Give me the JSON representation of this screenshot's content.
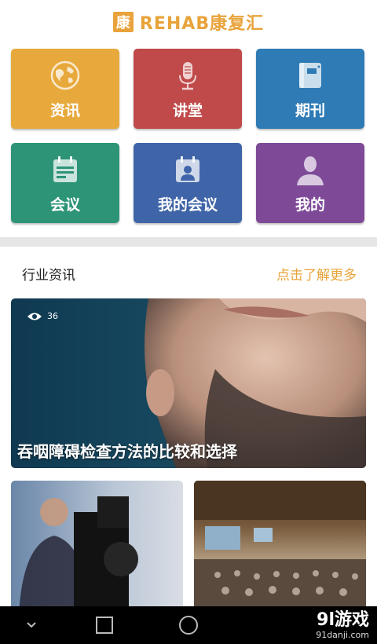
{
  "header": {
    "logo_char": "康",
    "title": "REHAB康复汇"
  },
  "tiles": [
    {
      "label": "资讯",
      "icon": "globe-icon",
      "color": "#e8a93c"
    },
    {
      "label": "讲堂",
      "icon": "microphone-icon",
      "color": "#c04a4a"
    },
    {
      "label": "期刊",
      "icon": "journal-icon",
      "color": "#2e7bb5"
    },
    {
      "label": "会议",
      "icon": "calendar-icon",
      "color": "#2e9478"
    },
    {
      "label": "我的会议",
      "icon": "my-meeting-icon",
      "color": "#3f64a8"
    },
    {
      "label": "我的",
      "icon": "user-icon",
      "color": "#7e4a98"
    }
  ],
  "section": {
    "title": "行业资讯",
    "more": "点击了解更多"
  },
  "feature": {
    "views": "36",
    "title": "吞咽障碍检查方法的比较和选择"
  },
  "watermark": {
    "main": "9l游戏",
    "sub": "91danji.com"
  }
}
